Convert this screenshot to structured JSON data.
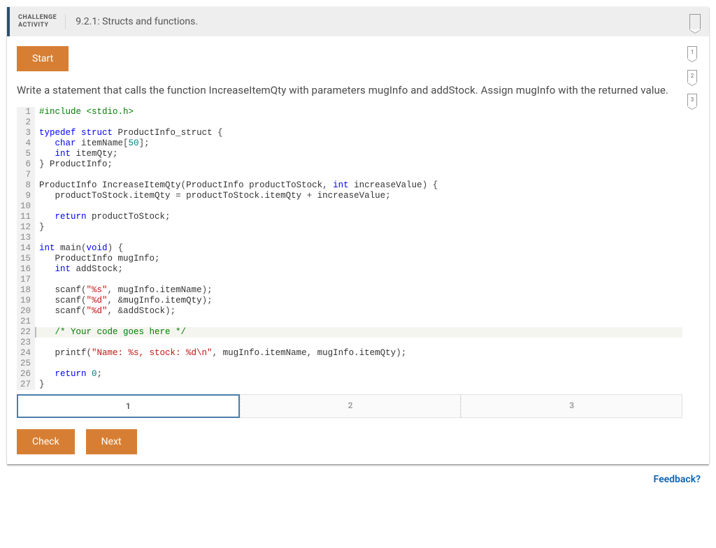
{
  "header": {
    "kicker_line1": "CHALLENGE",
    "kicker_line2": "ACTIVITY",
    "title": "9.2.1: Structs and functions."
  },
  "buttons": {
    "start": "Start",
    "check": "Check",
    "next": "Next"
  },
  "prompt": "Write a statement that calls the function IncreaseItemQty with parameters mugInfo and addStock. Assign mugInfo with the returned value.",
  "steps": {
    "s1": "1",
    "s2": "2",
    "s3": "3"
  },
  "tabs": {
    "t1": "1",
    "t2": "2",
    "t3": "3"
  },
  "feedback": "Feedback?",
  "chart_data": {
    "type": "table",
    "title": "C source (code editor contents)",
    "rows": [
      {
        "n": 1,
        "text": "#include <stdio.h>"
      },
      {
        "n": 2,
        "text": ""
      },
      {
        "n": 3,
        "text": "typedef struct ProductInfo_struct {"
      },
      {
        "n": 4,
        "text": "   char itemName[50];"
      },
      {
        "n": 5,
        "text": "   int itemQty;"
      },
      {
        "n": 6,
        "text": "} ProductInfo;"
      },
      {
        "n": 7,
        "text": ""
      },
      {
        "n": 8,
        "text": "ProductInfo IncreaseItemQty(ProductInfo productToStock, int increaseValue) {"
      },
      {
        "n": 9,
        "text": "   productToStock.itemQty = productToStock.itemQty + increaseValue;"
      },
      {
        "n": 10,
        "text": ""
      },
      {
        "n": 11,
        "text": "   return productToStock;"
      },
      {
        "n": 12,
        "text": "}"
      },
      {
        "n": 13,
        "text": ""
      },
      {
        "n": 14,
        "text": "int main(void) {"
      },
      {
        "n": 15,
        "text": "   ProductInfo mugInfo;"
      },
      {
        "n": 16,
        "text": "   int addStock;"
      },
      {
        "n": 17,
        "text": ""
      },
      {
        "n": 18,
        "text": "   scanf(\"%s\", mugInfo.itemName);"
      },
      {
        "n": 19,
        "text": "   scanf(\"%d\", &mugInfo.itemQty);"
      },
      {
        "n": 20,
        "text": "   scanf(\"%d\", &addStock);"
      },
      {
        "n": 21,
        "text": ""
      },
      {
        "n": 22,
        "text": "   /* Your code goes here */",
        "highlight": true
      },
      {
        "n": 23,
        "text": ""
      },
      {
        "n": 24,
        "text": "   printf(\"Name: %s, stock: %d\\n\", mugInfo.itemName, mugInfo.itemQty);"
      },
      {
        "n": 25,
        "text": ""
      },
      {
        "n": 26,
        "text": "   return 0;"
      },
      {
        "n": 27,
        "text": "}"
      }
    ]
  },
  "colors": {
    "accent": "#d67f34",
    "header_rule": "#2d4f6c",
    "link": "#0b63b4"
  }
}
